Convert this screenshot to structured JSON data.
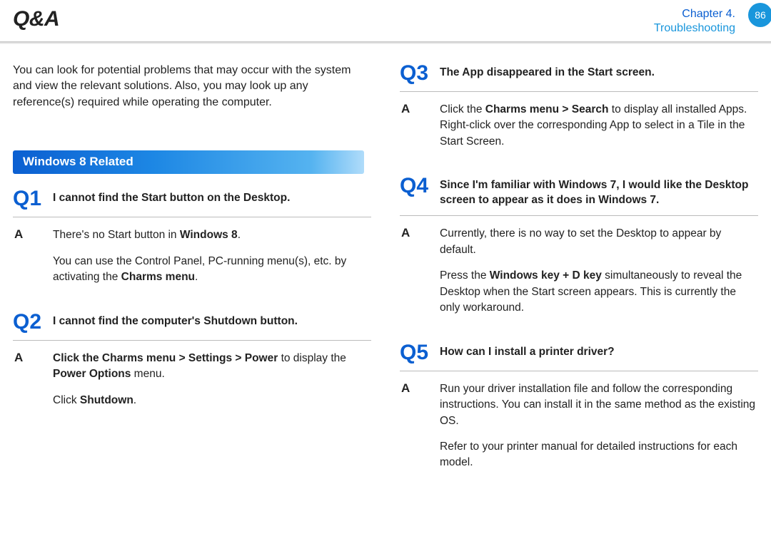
{
  "header": {
    "title": "Q&A",
    "chapter_line1": "Chapter 4.",
    "chapter_line2": "Troubleshooting",
    "page_number": "86"
  },
  "intro": "You can look for potential problems that may occur with the system and view the relevant solutions. Also, you may look up any reference(s) required while operating the computer.",
  "section_heading": "Windows 8 Related",
  "qa": {
    "q1": {
      "num": "Q1",
      "question": "I cannot find the Start button on the Desktop.",
      "a_label": "A",
      "a_p1_pre": "There's no Start button in ",
      "a_p1_b": "Windows 8",
      "a_p1_post": ".",
      "a_p2_pre": "You can use the Control Panel, PC-running menu(s), etc. by activating the ",
      "a_p2_b": "Charms menu",
      "a_p2_post": "."
    },
    "q2": {
      "num": "Q2",
      "question": "I cannot find the computer's Shutdown button.",
      "a_label": "A",
      "a_p1_b1": "Click the Charms menu > Settings > Power",
      "a_p1_mid": " to display the ",
      "a_p1_b2": "Power Options",
      "a_p1_post": " menu.",
      "a_p2_pre": "Click ",
      "a_p2_b": "Shutdown",
      "a_p2_post": "."
    },
    "q3": {
      "num": "Q3",
      "question": "The App disappeared in the Start screen.",
      "a_label": "A",
      "a_p1_pre": "Click the ",
      "a_p1_b": "Charms menu > Search",
      "a_p1_post": " to display all installed Apps. Right-click over the corresponding App to select in a Tile in the Start Screen."
    },
    "q4": {
      "num": "Q4",
      "question": "Since I'm familiar with Windows 7, I would like the Desktop screen to appear as it does in Windows 7.",
      "a_label": "A",
      "a_p1": "Currently, there is no way to set the Desktop to appear by default.",
      "a_p2_pre": "Press the ",
      "a_p2_b": "Windows key + D key",
      "a_p2_post": " simultaneously to reveal the Desktop when the Start screen appears. This is currently the only workaround."
    },
    "q5": {
      "num": "Q5",
      "question": "How can I install a printer driver?",
      "a_label": "A",
      "a_p1": "Run your driver installation file and follow the corresponding instructions. You can install it in the same method as the existing OS.",
      "a_p2": "Refer to your printer manual for detailed instructions for each model."
    }
  }
}
